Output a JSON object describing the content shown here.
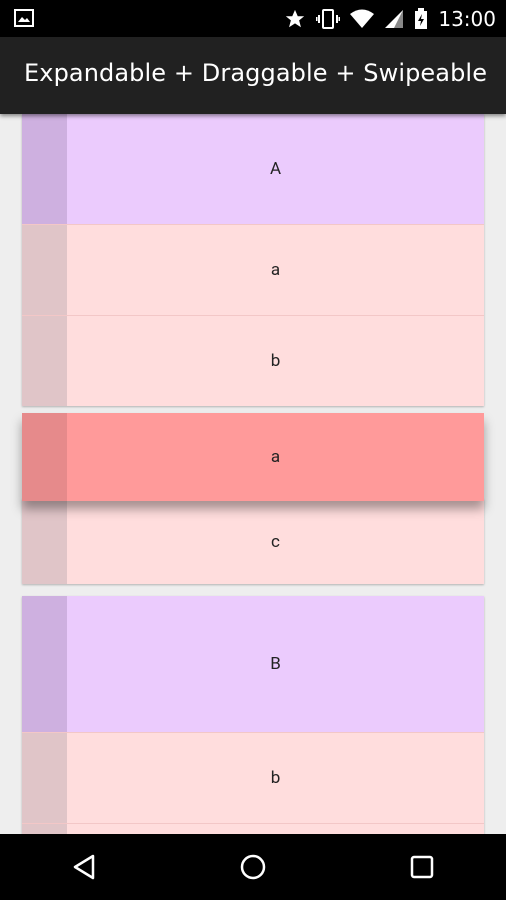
{
  "status_bar": {
    "time": "13:00",
    "icons": [
      "image-icon",
      "star-icon",
      "vibrate-icon",
      "wifi-icon",
      "signal-icon",
      "battery-icon"
    ]
  },
  "app_bar": {
    "title": "Expandable + Draggable + Swipeable"
  },
  "list": {
    "group1": {
      "label": "A",
      "children": [
        "a",
        "b"
      ]
    },
    "dragging": {
      "label": "a"
    },
    "group1_extra_child": "c",
    "group2": {
      "label": "B",
      "children": [
        "b"
      ]
    }
  },
  "nav_bar": {
    "buttons": [
      "back-icon",
      "home-icon",
      "recents-icon"
    ]
  },
  "colors": {
    "group_bg": "#ebcbfd",
    "child_bg": "#ffdddd",
    "drag_bg": "#ff9a9a",
    "appbar": "#212121"
  }
}
